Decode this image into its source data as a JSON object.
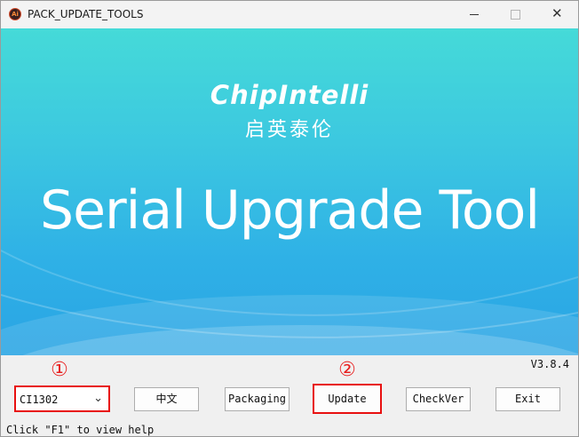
{
  "window": {
    "title": "PACK_UPDATE_TOOLS",
    "app_icon_text": "Ai"
  },
  "banner": {
    "logo": "ChipIntelli",
    "logo_cn": "启英泰伦",
    "title": "Serial Upgrade Tool"
  },
  "version": "V3.8.4",
  "markers": {
    "one": "①",
    "two": "②"
  },
  "chip_select": {
    "value": "CI1302"
  },
  "buttons": {
    "language": "中文",
    "packaging": "Packaging",
    "update": "Update",
    "checkver": "CheckVer",
    "exit": "Exit"
  },
  "status_bar": "Click \"F1\" to view help",
  "colors": {
    "highlight": "#e81010",
    "banner_top": "#45dad8",
    "banner_bottom": "#2aa4e4"
  }
}
